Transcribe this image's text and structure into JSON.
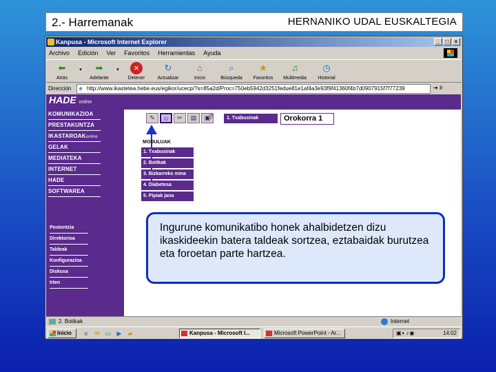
{
  "slide": {
    "title_left": "2.- Harremanak",
    "title_right": "HERNANIKO UDAL EUSKALTEGIA",
    "note": "Ingurune komunikatibo honek ahalbidetzen dizu ikaskideekin batera taldeak sortzea, eztabaidak burutzea eta foroetan parte hartzea."
  },
  "window": {
    "title": "Kanpusa - Microsoft Internet Explorer",
    "menu": [
      "Archivo",
      "Edición",
      "Ver",
      "Favoritos",
      "Herramientas",
      "Ayuda"
    ],
    "toolbar": [
      {
        "label": "Atrás",
        "icon": "back-arrow-icon"
      },
      {
        "label": "Adelante",
        "icon": "forward-arrow-icon"
      },
      {
        "label": "Detener",
        "icon": "stop-icon"
      },
      {
        "label": "Actualizar",
        "icon": "refresh-icon"
      },
      {
        "label": "Inicio",
        "icon": "home-icon"
      },
      {
        "label": "Búsqueda",
        "icon": "search-icon"
      },
      {
        "label": "Favoritos",
        "icon": "favorites-icon"
      },
      {
        "label": "Multimedia",
        "icon": "multimedia-icon"
      },
      {
        "label": "Historial",
        "icon": "history-icon"
      }
    ],
    "address_label": "Dirección",
    "address_value": "http://www.ikastetea.hebe.eus/egikor/ucecp/?s=85a2d/Proc=750eb5942d3251fedue81e1af4a3e93f9f41360f4b7d0907915f7f77239",
    "go_label": "Ir",
    "status_left": "2. Botikak",
    "status_right": "Internet"
  },
  "site": {
    "logo": "HADE",
    "logo_sub": "online",
    "nav": [
      "KOMUNIKAZIOA",
      "PRESTAKUNTZA",
      "IKASTAROAK",
      "GELAK",
      "MEDIATEKA",
      "INTERNET",
      "HADE",
      "SOFTWAREA"
    ],
    "nav_ikastaroak_suffix": "online",
    "lower_nav": [
      "Postontzia",
      "Direktorioa",
      "Taldeak",
      "Konfigurazioa",
      "Diskusa",
      "Irten"
    ],
    "breadcrumb": "1. Txabusinak",
    "page_name": "Orokorra 1",
    "modules_title": "MODULUAK",
    "modules": [
      "1. Txabusinak",
      "2. Botikak",
      "3. Bizkarreko mina",
      "4. Diabetesa",
      "5. Pipiak jana"
    ],
    "module_icons": [
      "pencil-icon",
      "group-icon",
      "tools-icon",
      "chart-icon",
      "computer-icon"
    ],
    "help_glyph": "?"
  },
  "taskbar": {
    "start": "Inicio",
    "tasks": [
      "Kanpusa - Microsoft I...",
      "Microsoft PowerPoint - Ar..."
    ],
    "clock": "14:02"
  }
}
